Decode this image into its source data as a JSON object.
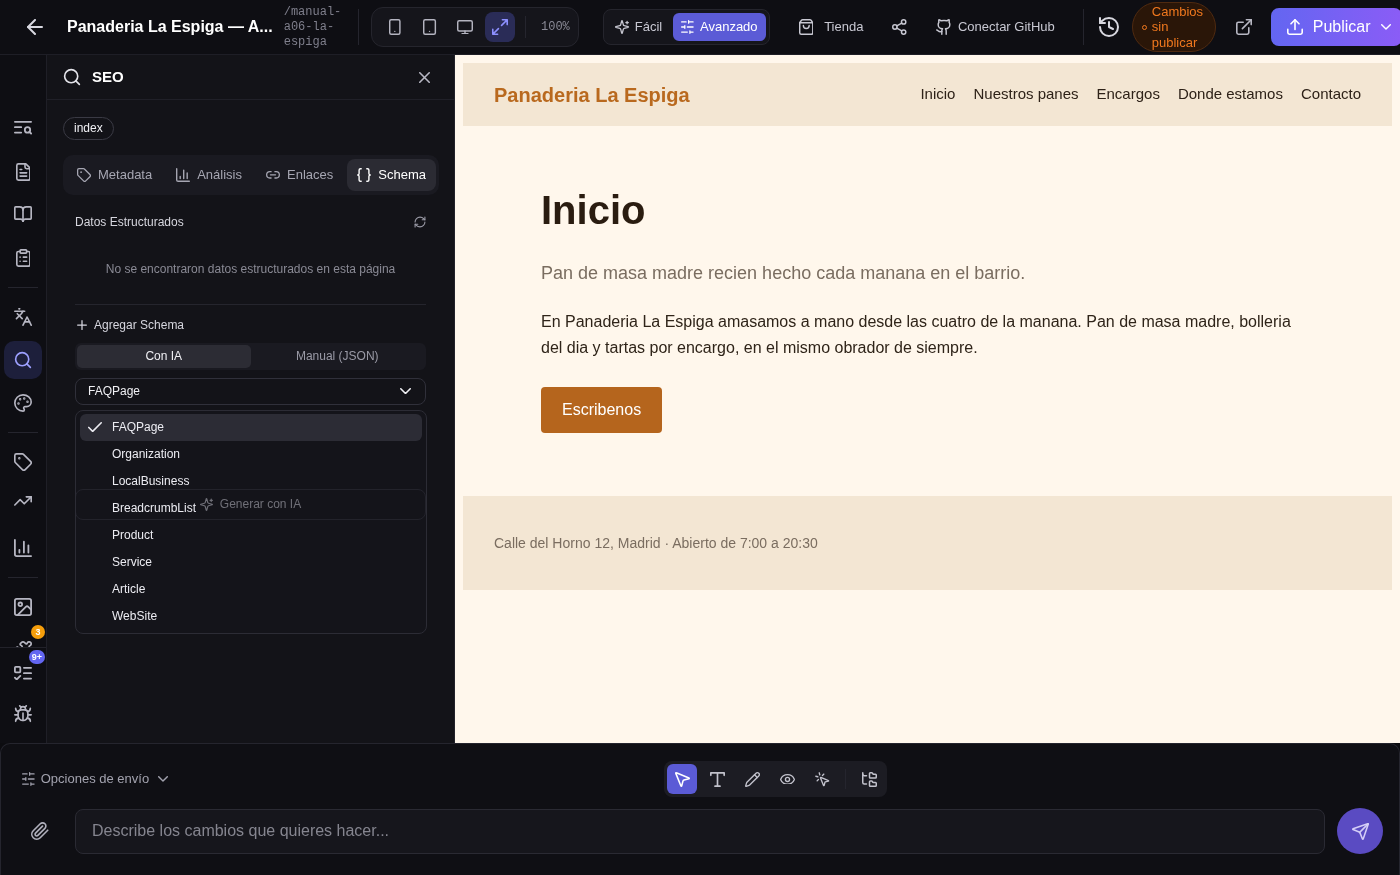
{
  "topbar": {
    "title": "Panaderia La Espiga — A...",
    "path": "/manual-a06-la-espiga",
    "devices": [
      {
        "kind": "phone",
        "selected": false
      },
      {
        "kind": "tablet",
        "selected": false
      },
      {
        "kind": "desktop",
        "selected": false
      },
      {
        "kind": "fit",
        "selected": true
      }
    ],
    "zoom": "100%",
    "modes": [
      {
        "label": "Fácil",
        "kind": "sparkles",
        "selected": false
      },
      {
        "label": "Avanzado",
        "kind": "sliders",
        "selected": true
      }
    ],
    "actions": [
      {
        "kind": "bag",
        "label": "Tienda"
      },
      {
        "kind": "share"
      },
      {
        "kind": "github",
        "label": "Conectar GitHub"
      }
    ],
    "status": "Cambios sin publicar",
    "publish": "Publicar"
  },
  "rail": {
    "groups": [
      [
        {
          "kind": "text-search",
          "selected": false
        },
        {
          "kind": "file",
          "selected": false
        },
        {
          "kind": "book",
          "selected": false
        },
        {
          "kind": "clipboard",
          "selected": false
        }
      ],
      [
        {
          "kind": "languages",
          "selected": false
        },
        {
          "kind": "search",
          "selected": true
        },
        {
          "kind": "palette",
          "selected": false
        }
      ],
      [
        {
          "kind": "tag",
          "selected": false
        },
        {
          "kind": "trending",
          "selected": false
        },
        {
          "kind": "chart",
          "selected": false
        }
      ],
      [
        {
          "kind": "image",
          "selected": false
        },
        {
          "kind": "puzzle",
          "selected": false,
          "badge": {
            "text": "3",
            "color": "#f59e0b"
          }
        }
      ]
    ],
    "pinned": [
      {
        "kind": "list-todo",
        "selected": false,
        "badge": {
          "text": "9+",
          "color": "#6366f1"
        }
      },
      {
        "kind": "bug",
        "selected": false
      }
    ]
  },
  "seo": {
    "title": "SEO",
    "page": "index",
    "tabs": [
      {
        "label": "Metadata",
        "kind": "tag",
        "selected": false
      },
      {
        "label": "Análisis",
        "kind": "chart",
        "selected": false
      },
      {
        "label": "Enlaces",
        "kind": "link",
        "selected": false
      },
      {
        "label": "Schema",
        "kind": "braces",
        "selected": true
      }
    ],
    "section_title": "Datos Estructurados",
    "empty_message": "No se encontraron datos estructurados en esta página",
    "add_label": "Agregar Schema",
    "methods": [
      {
        "label": "Con IA",
        "selected": true
      },
      {
        "label": "Manual (JSON)",
        "selected": false
      }
    ],
    "schema_type": {
      "value": "FAQPage",
      "expanded": true,
      "options": [
        {
          "label": "FAQPage",
          "selected": true
        },
        {
          "label": "Organization",
          "selected": false
        },
        {
          "label": "LocalBusiness",
          "selected": false
        },
        {
          "label": "BreadcrumbList",
          "selected": false
        },
        {
          "label": "Product",
          "selected": false
        },
        {
          "label": "Service",
          "selected": false
        },
        {
          "label": "Article",
          "selected": false
        },
        {
          "label": "WebSite",
          "selected": false
        }
      ]
    },
    "generate": {
      "label": "Generar con IA",
      "disabled": true
    }
  },
  "preview": {
    "brand": "Panaderia La Espiga",
    "nav": [
      "Inicio",
      "Nuestros panes",
      "Encargos",
      "Donde estamos",
      "Contacto"
    ],
    "heading": "Inicio",
    "lead": "Pan de masa madre recien hecho cada manana en el barrio.",
    "body": "En Panaderia La Espiga amasamos a mano desde las cuatro de la manana. Pan de masa madre, bolleria del dia y tartas por encargo, en el mismo obrador de siempre.",
    "cta": "Escribenos",
    "footer": "Calle del Horno 12, Madrid · Abierto de 7:00 a 20:30"
  },
  "composer": {
    "options_label": "Opciones de envío",
    "tools": [
      [
        {
          "kind": "pointer",
          "selected": true
        },
        {
          "kind": "text",
          "selected": false
        },
        {
          "kind": "pencil",
          "selected": false
        },
        {
          "kind": "eye",
          "selected": false
        },
        {
          "kind": "magic",
          "selected": false
        }
      ],
      [
        {
          "kind": "tree",
          "selected": false
        }
      ]
    ],
    "placeholder": "Describe los cambios que quieres hacer..."
  }
}
